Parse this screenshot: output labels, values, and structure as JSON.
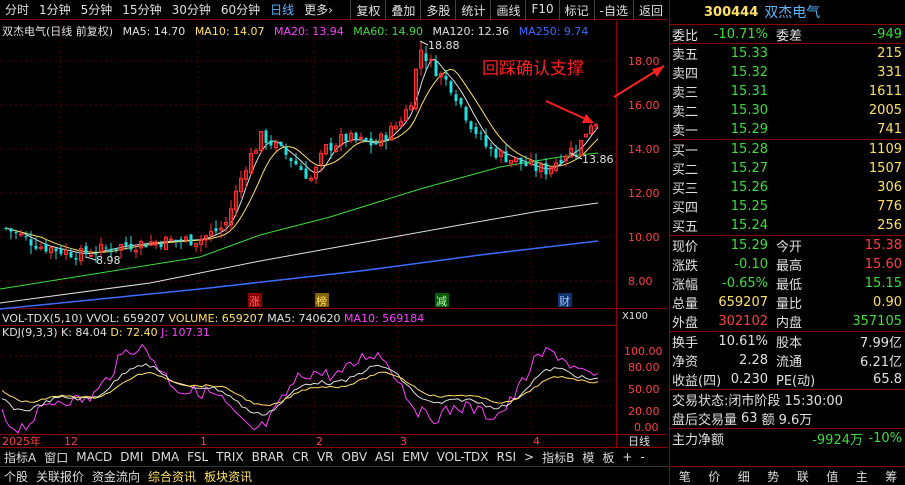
{
  "toolbar": {
    "periods": [
      "分时",
      "1分钟",
      "5分钟",
      "15分钟",
      "30分钟",
      "60分钟",
      "日线",
      "更多"
    ],
    "active_period": "日线",
    "more_arrow": "›",
    "buttons": [
      "复权",
      "叠加",
      "多股",
      "统计",
      "画线",
      "F10",
      "标记",
      "-自选",
      "返回"
    ]
  },
  "chart": {
    "legend": {
      "title": "双杰电气(日线 前复权)",
      "ma5": "MA5: 14.70",
      "ma10": "MA10: 14.07",
      "ma20": "MA20: 13.94",
      "ma60": "MA60: 14.90",
      "ma120": "MA120: 12.36",
      "ma250": "MA250: 9.74"
    },
    "y_ticks": [
      "18.00",
      "16.00",
      "14.00",
      "12.00",
      "10.00",
      "8.00"
    ],
    "high_label": "18.88",
    "low_label": "8.98",
    "last_label": "13.86",
    "annotation": "回踩确认支撑",
    "markers": [
      "涨",
      "榜",
      "减",
      "财"
    ],
    "vol_legend": {
      "name": "VOL-TDX(5,10)",
      "vvol": "VVOL: 659207",
      "volume": "VOLUME: 659207",
      "ma5": "MA5: 740620",
      "ma10": "MA10: 569184"
    },
    "vol_unit": "X100",
    "kdj_legend": {
      "name": "KDJ(9,3,3)",
      "k": "K: 84.04",
      "d": "D: 72.40",
      "j": "J: 107.31"
    },
    "kdj_ticks": [
      "100.00",
      "80.00",
      "50.00",
      "20.00",
      "0.00"
    ],
    "x_labels": [
      "2025年",
      "12",
      "1",
      "2",
      "3",
      "4"
    ],
    "period_tag": "日线"
  },
  "tabs": {
    "row1": [
      "指标A",
      "窗口",
      "MACD",
      "DMI",
      "DMA",
      "FSL",
      "TRIX",
      "BRAR",
      "CR",
      "VR",
      "OBV",
      "ASI",
      "EMV",
      "VOL-TDX",
      "RSI",
      ">",
      "指标B",
      "模",
      "板",
      "+",
      "-"
    ],
    "row2": [
      "个股",
      "关联报价",
      "资金流向",
      "综合资讯",
      "板块资讯"
    ]
  },
  "quote": {
    "code": "300444",
    "name": "双杰电气",
    "webi_label": "委比",
    "webi": "-10.71%",
    "weicha_label": "委差",
    "weicha": "-949",
    "asks": [
      {
        "label": "卖五",
        "price": "15.33",
        "vol": "215"
      },
      {
        "label": "卖四",
        "price": "15.32",
        "vol": "331"
      },
      {
        "label": "卖三",
        "price": "15.31",
        "vol": "1611"
      },
      {
        "label": "卖二",
        "price": "15.30",
        "vol": "2005"
      },
      {
        "label": "卖一",
        "price": "15.29",
        "vol": "741"
      }
    ],
    "bids": [
      {
        "label": "买一",
        "price": "15.28",
        "vol": "1109"
      },
      {
        "label": "买二",
        "price": "15.27",
        "vol": "1507"
      },
      {
        "label": "买三",
        "price": "15.26",
        "vol": "306"
      },
      {
        "label": "买四",
        "price": "15.25",
        "vol": "776"
      },
      {
        "label": "买五",
        "price": "15.24",
        "vol": "256"
      }
    ],
    "stats1": [
      {
        "l1": "现价",
        "v1": "15.29",
        "l2": "今开",
        "v2": "15.38"
      },
      {
        "l1": "涨跌",
        "v1": "-0.10",
        "l2": "最高",
        "v2": "15.60"
      },
      {
        "l1": "涨幅",
        "v1": "-0.65%",
        "l2": "最低",
        "v2": "15.15"
      },
      {
        "l1": "总量",
        "v1": "659207",
        "l2": "量比",
        "v2": "0.90"
      },
      {
        "l1": "外盘",
        "v1": "302102",
        "l2": "内盘",
        "v2": "357105"
      }
    ],
    "stats2": [
      {
        "l1": "换手",
        "v1": "10.61%",
        "l2": "股本",
        "v2": "7.99亿"
      },
      {
        "l1": "净资",
        "v1": "2.28",
        "l2": "流通",
        "v2": "6.21亿"
      },
      {
        "l1": "收益(四)",
        "v1": "0.230",
        "l2": "PE(动)",
        "v2": "65.8"
      }
    ],
    "trade_state_label": "交易状态:",
    "trade_state": "闭市阶段 15:30:00",
    "after_label": "盘后交易量",
    "after_vol": "63",
    "after_amt_label": "额",
    "after_amt": "9.6万",
    "net_label": "主力净额",
    "net_value": "-9924万",
    "net_pct": "-10%",
    "nav": [
      "笔",
      "价",
      "细",
      "势",
      "联",
      "值",
      "主",
      "筹"
    ]
  }
}
